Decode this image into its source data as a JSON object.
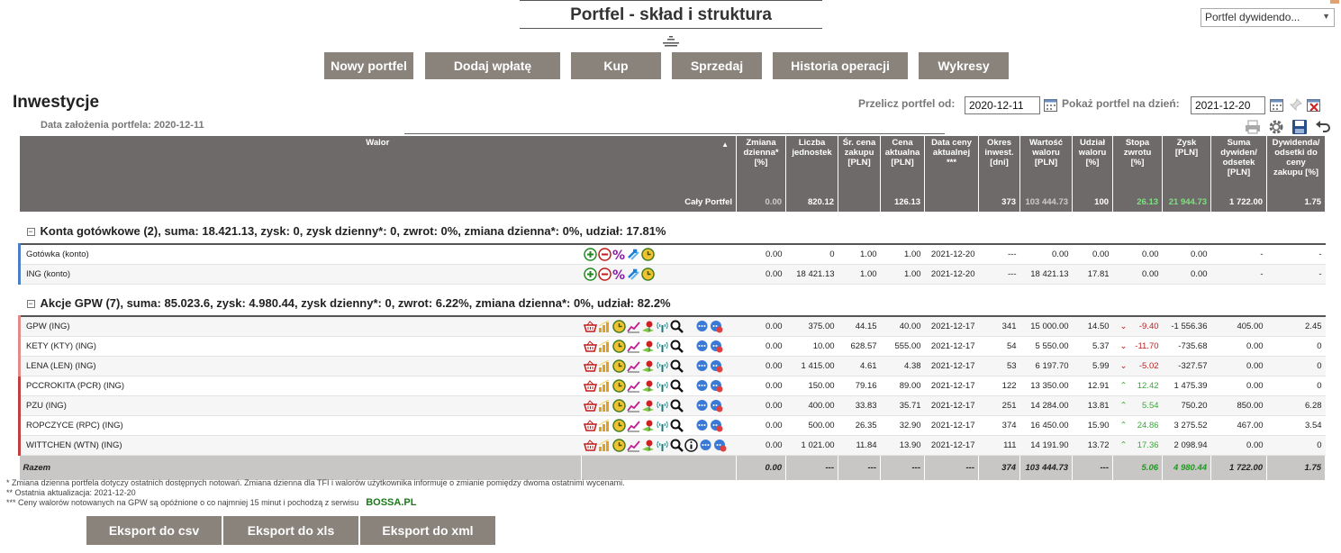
{
  "page_title": "Portfel - skład i struktura",
  "portfolio_select": "Portfel dywidendo...",
  "buttons": [
    "Nowy portfel",
    "Dodaj wpłatę",
    "Kup",
    "Sprzedaj",
    "Historia operacji",
    "Wykresy"
  ],
  "section_title": "Inwestycje",
  "founded": "Data założenia portfela: 2020-12-11",
  "recalc_label": "Przelicz portfel od:",
  "recalc_date": "2020-12-11",
  "show_label": "Pokaż portfel na dzień:",
  "show_date": "2021-12-20",
  "headers": {
    "walor": "Walor",
    "zmiana": "Zmiana dzienna* [%]",
    "liczba": "Liczba jednostek",
    "sr_cena": "Śr. cena zakupu [PLN]",
    "cena": "Cena aktualna [PLN]",
    "data": "Data ceny aktualnej ***",
    "okres": "Okres inwest. [dni]",
    "wartosc": "Wartość waloru [PLN]",
    "udzial": "Udział waloru [%]",
    "stopa": "Stopa zwrotu [%]",
    "zysk": "Zysk [PLN]",
    "suma_dyw": "Suma dywiden/ odsetek [PLN]",
    "dyw_proc": "Dywidenda/ odsetki do ceny zakupu [%]"
  },
  "summary": {
    "label": "Cały Portfel",
    "zmiana": "0.00",
    "liczba": "820.12",
    "sr_cena": "",
    "cena": "126.13",
    "data": "",
    "okres": "373",
    "wartosc": "103 444.73",
    "udzial": "100",
    "stopa": "26.13",
    "zysk": "21 944.73",
    "suma_dyw": "1 722.00",
    "dyw_proc": "1.75"
  },
  "group_cash": "Konta gotówkowe (2), suma: 18.421.13, zysk: 0, zysk dzienny*: 0, zwrot: 0%, zmiana dzienna*: 0%, udział: 17.81%",
  "cash_rows": [
    {
      "name": "Gotówka (konto)",
      "zmiana": "0.00",
      "liczba": "0",
      "sr_cena": "1.00",
      "cena": "1.00",
      "data": "2021-12-20",
      "okres": "---",
      "wartosc": "0.00",
      "udzial": "0.00",
      "stopa": "0.00",
      "zysk": "0.00",
      "suma_dyw": "-",
      "dyw_proc": "-"
    },
    {
      "name": "ING (konto)",
      "zmiana": "0.00",
      "liczba": "18 421.13",
      "sr_cena": "1.00",
      "cena": "1.00",
      "data": "2021-12-20",
      "okres": "---",
      "wartosc": "18 421.13",
      "udzial": "17.81",
      "stopa": "0.00",
      "zysk": "0.00",
      "suma_dyw": "-",
      "dyw_proc": "-"
    }
  ],
  "group_stocks": "Akcje GPW (7), suma: 85.023.6, zysk: 4.980.44, zysk dzienny*: 0, zwrot: 6.22%, zmiana dzienna*: 0%, udział: 82.2%",
  "stock_rows": [
    {
      "name": "GPW (ING)",
      "zmiana": "0.00",
      "liczba": "375.00",
      "sr_cena": "44.15",
      "cena": "40.00",
      "data": "2021-12-17",
      "okres": "341",
      "wartosc": "15 000.00",
      "udzial": "14.50",
      "dir": "down",
      "stopa": "-9.40",
      "zysk": "-1 556.36",
      "suma_dyw": "405.00",
      "dyw_proc": "2.45"
    },
    {
      "name": "KETY (KTY) (ING)",
      "zmiana": "0.00",
      "liczba": "10.00",
      "sr_cena": "628.57",
      "cena": "555.00",
      "data": "2021-12-17",
      "okres": "54",
      "wartosc": "5 550.00",
      "udzial": "5.37",
      "dir": "down",
      "stopa": "-11.70",
      "zysk": "-735.68",
      "suma_dyw": "0.00",
      "dyw_proc": "0"
    },
    {
      "name": "LENA (LEN) (ING)",
      "zmiana": "0.00",
      "liczba": "1 415.00",
      "sr_cena": "4.61",
      "cena": "4.38",
      "data": "2021-12-17",
      "okres": "53",
      "wartosc": "6 197.70",
      "udzial": "5.99",
      "dir": "down",
      "stopa": "-5.02",
      "zysk": "-327.57",
      "suma_dyw": "0.00",
      "dyw_proc": "0"
    },
    {
      "name": "PCCROKITA (PCR) (ING)",
      "zmiana": "0.00",
      "liczba": "150.00",
      "sr_cena": "79.16",
      "cena": "89.00",
      "data": "2021-12-17",
      "okres": "122",
      "wartosc": "13 350.00",
      "udzial": "12.91",
      "dir": "up",
      "stopa": "12.42",
      "zysk": "1 475.39",
      "suma_dyw": "0.00",
      "dyw_proc": "0"
    },
    {
      "name": "PZU (ING)",
      "zmiana": "0.00",
      "liczba": "400.00",
      "sr_cena": "33.83",
      "cena": "35.71",
      "data": "2021-12-17",
      "okres": "251",
      "wartosc": "14 284.00",
      "udzial": "13.81",
      "dir": "up",
      "stopa": "5.54",
      "zysk": "750.20",
      "suma_dyw": "850.00",
      "dyw_proc": "6.28"
    },
    {
      "name": "ROPCZYCE (RPC) (ING)",
      "zmiana": "0.00",
      "liczba": "500.00",
      "sr_cena": "26.35",
      "cena": "32.90",
      "data": "2021-12-17",
      "okres": "374",
      "wartosc": "16 450.00",
      "udzial": "15.90",
      "dir": "up",
      "stopa": "24.86",
      "zysk": "3 275.52",
      "suma_dyw": "467.00",
      "dyw_proc": "3.54"
    },
    {
      "name": "WITTCHEN (WTN) (ING)",
      "zmiana": "0.00",
      "liczba": "1 021.00",
      "sr_cena": "11.84",
      "cena": "13.90",
      "data": "2021-12-17",
      "okres": "111",
      "wartosc": "14 191.90",
      "udzial": "13.72",
      "dir": "up",
      "stopa": "17.36",
      "zysk": "2 098.94",
      "suma_dyw": "0.00",
      "dyw_proc": "0"
    }
  ],
  "total": {
    "label": "Razem",
    "zmiana": "0.00",
    "liczba": "---",
    "sr_cena": "---",
    "cena": "---",
    "data": "---",
    "okres": "374",
    "wartosc": "103 444.73",
    "udzial": "---",
    "stopa": "5.06",
    "zysk": "4 980.44",
    "suma_dyw": "1 722.00",
    "dyw_proc": "1.75"
  },
  "footnotes": [
    "* Zmiana dzienna portfela dotyczy ostatnich dostępnych notowań. Zmiana dzienna dla TFI i walorów użytkownika informuje o zmianie pomiędzy dwoma ostatnimi wycenami.",
    "** Ostatnia aktualizacja: 2021-12-20",
    "*** Ceny walorów notowanych na GPW są opóźnione o co najmniej 15 minut i pochodzą z serwisu"
  ],
  "bossa": "BOSSA.PL",
  "export_buttons": [
    "Eksport do csv",
    "Eksport do xls",
    "Eksport do xml"
  ],
  "colors": {
    "button": "#8a837c",
    "header": "#6e6a6a",
    "positive": "#1d9a1d",
    "negative": "#c02020"
  }
}
